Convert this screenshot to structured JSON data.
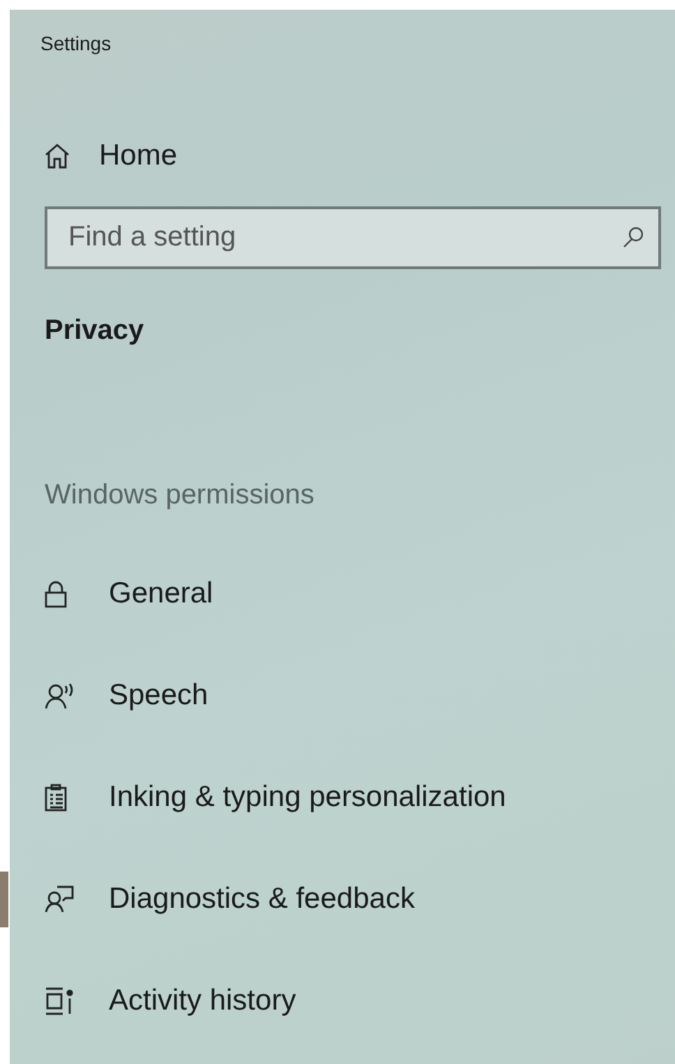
{
  "window": {
    "title": "Settings"
  },
  "home": {
    "label": "Home"
  },
  "search": {
    "placeholder": "Find a setting"
  },
  "section_title": "Privacy",
  "group_heading": "Windows permissions",
  "items": [
    {
      "label": "General",
      "selected": false
    },
    {
      "label": "Speech",
      "selected": false
    },
    {
      "label": "Inking & typing personalization",
      "selected": false
    },
    {
      "label": "Diagnostics & feedback",
      "selected": true
    },
    {
      "label": "Activity history",
      "selected": false
    }
  ]
}
